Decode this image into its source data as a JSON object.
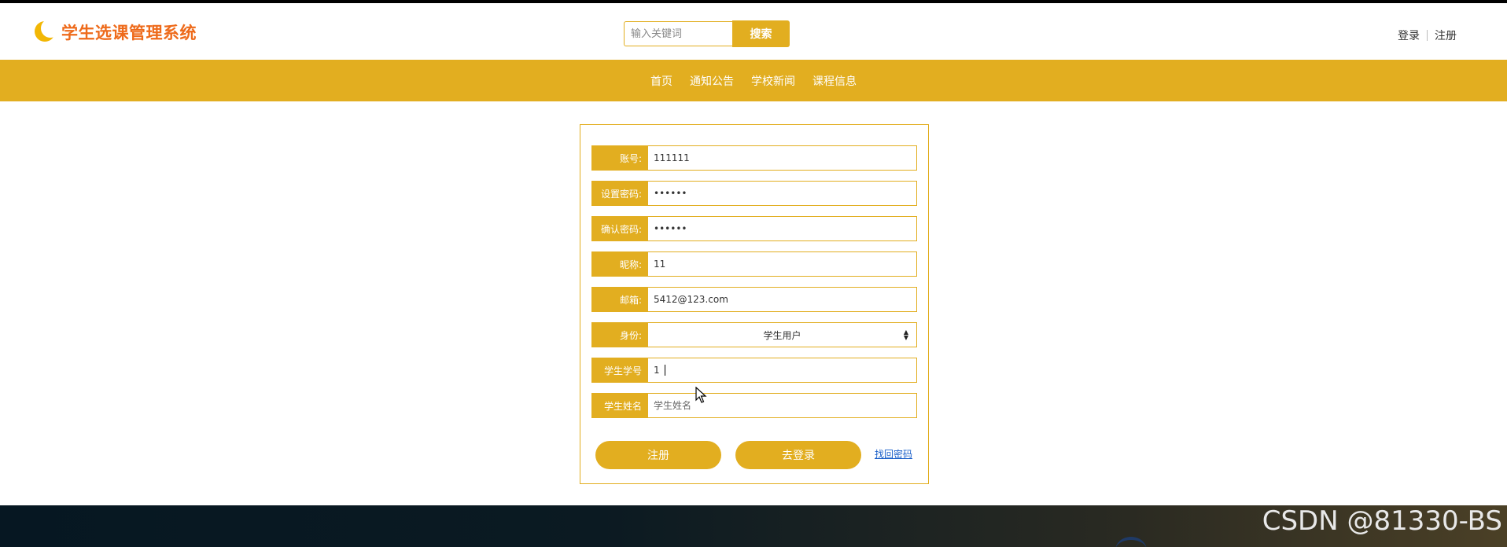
{
  "header": {
    "logo_text": "学生选课管理系统",
    "search": {
      "placeholder": "输入关键词",
      "button_label": "搜索"
    },
    "auth": {
      "login_label": "登录",
      "register_label": "注册"
    }
  },
  "nav": {
    "items": [
      {
        "label": "首页"
      },
      {
        "label": "通知公告"
      },
      {
        "label": "学校新闻"
      },
      {
        "label": "课程信息"
      }
    ]
  },
  "form": {
    "account": {
      "label": "账号:",
      "value": "111111"
    },
    "password": {
      "label": "设置密码:",
      "value": "••••••"
    },
    "confirm_password": {
      "label": "确认密码:",
      "value": "••••••"
    },
    "nickname": {
      "label": "昵称:",
      "value": "11"
    },
    "email": {
      "label": "邮箱:",
      "value": "5412@123.com"
    },
    "identity": {
      "label": "身份:",
      "value": "学生用户"
    },
    "student_id": {
      "label": "学生学号",
      "value": "1"
    },
    "student_name": {
      "label": "学生姓名",
      "placeholder": "学生姓名"
    },
    "register_button": "注册",
    "login_button": "去登录",
    "recover_link": "找回密码"
  },
  "watermark": "CSDN @81330-BS",
  "colors": {
    "accent": "#e2ae20",
    "logo": "#ee6a1a",
    "link": "#1a5fc9"
  }
}
